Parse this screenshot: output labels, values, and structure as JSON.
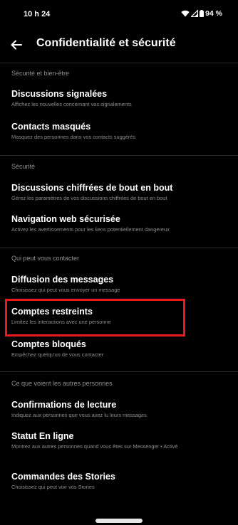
{
  "status_bar": {
    "time": "10 h 24",
    "battery": "94 %"
  },
  "header": {
    "title": "Confidentialité et sécurité"
  },
  "sections": [
    {
      "label": "Sécurité et bien-être",
      "items": [
        {
          "title": "Discussions signalées",
          "subtitle": "Affichez les nouvelles concernant vos signalements"
        },
        {
          "title": "Contacts masqués",
          "subtitle": "Masquez des personnes dans vos contacts suggérés"
        }
      ]
    },
    {
      "label": "Sécurité",
      "items": [
        {
          "title": "Discussions chiffrées de bout en bout",
          "subtitle": "Gérez les paramètres de vos discussions chiffrées de bout en bout"
        },
        {
          "title": "Navigation web sécurisée",
          "subtitle": "Activez les avertissements pour les liens potentiellement dangereux"
        }
      ]
    },
    {
      "label": "Qui peut vous contacter",
      "items": [
        {
          "title": "Diffusion des messages",
          "subtitle": "Choisissez qui peut vous envoyer un message"
        },
        {
          "title": "Comptes restreints",
          "subtitle": "Limitez les interactions avec une personne"
        },
        {
          "title": "Comptes bloqués",
          "subtitle": "Empêchez quelqu'un de vous contacter"
        }
      ]
    },
    {
      "label": "Ce que voient les autres personnes",
      "items": [
        {
          "title": "Confirmations de lecture",
          "subtitle": "Indiquez aux personnes que vous avez lu leurs messages"
        },
        {
          "title": "Statut En ligne",
          "subtitle": "Montrez aux autres personnes quand vous êtes sur Messenger • Activé"
        },
        {
          "title": "Commandes des Stories",
          "subtitle": "Choisissez qui peut voir vos Stories"
        }
      ]
    }
  ],
  "colors": {
    "background": "#000000",
    "highlight": "#ee1a1a",
    "secondary_text": "#8c8c8c"
  },
  "icons": [
    "back-arrow-icon",
    "wifi-icon",
    "signal-icon",
    "battery-icon"
  ]
}
